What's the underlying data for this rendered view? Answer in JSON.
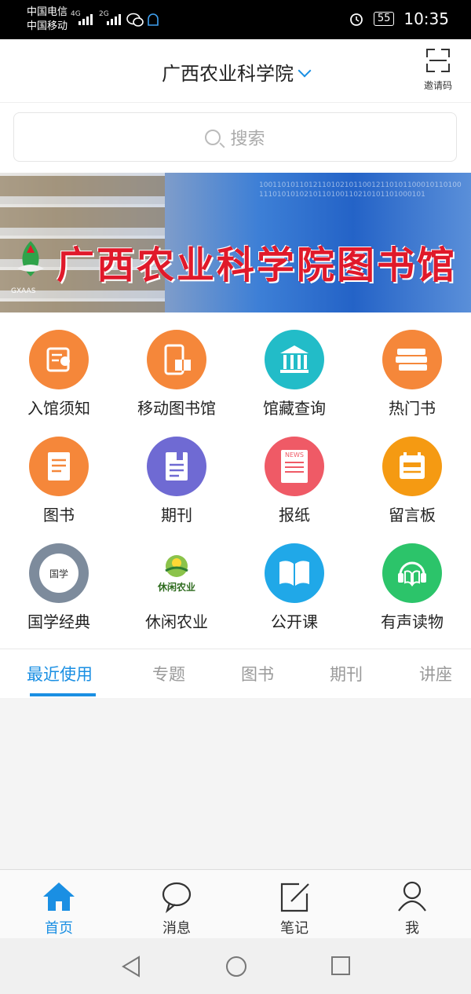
{
  "status_bar": {
    "carrier1": "中国电信",
    "carrier2": "中国移动",
    "net1": "4G",
    "net2": "2G",
    "battery": "55",
    "time": "10:35"
  },
  "header": {
    "title": "广西农业科学院",
    "invite_label": "邀请码"
  },
  "search": {
    "placeholder": "搜索"
  },
  "banner": {
    "title": "广西农业科学院图书馆",
    "logo_text": "GXAAS"
  },
  "grid": [
    {
      "label": "入馆须知",
      "icon": "scroll-icon",
      "color": "#f5873a"
    },
    {
      "label": "移动图书馆",
      "icon": "phone-book-icon",
      "color": "#f5873a"
    },
    {
      "label": "馆藏查询",
      "icon": "library-building-icon",
      "color": "#22bcc8"
    },
    {
      "label": "热门书",
      "icon": "book-stack-icon",
      "color": "#f5873a"
    },
    {
      "label": "图书",
      "icon": "book-icon",
      "color": "#f5873a"
    },
    {
      "label": "期刊",
      "icon": "journal-icon",
      "color": "#6f6ad3"
    },
    {
      "label": "报纸",
      "icon": "newspaper-icon",
      "color": "#ef5a66"
    },
    {
      "label": "留言板",
      "icon": "calendar-board-icon",
      "color": "#f59a12"
    },
    {
      "label": "国学经典",
      "icon": "classics-icon",
      "color": "#7d8b9c"
    },
    {
      "label": "休闲农业",
      "icon": "leisure-agriculture-icon",
      "color": "#ffffff"
    },
    {
      "label": "公开课",
      "icon": "open-book-icon",
      "color": "#20a8e8"
    },
    {
      "label": "有声读物",
      "icon": "audio-book-icon",
      "color": "#2cc46a"
    }
  ],
  "grid_extra": {
    "news_text": "NEWS",
    "guoxue_text": "国学",
    "leisure_text": "休闲农业"
  },
  "tabs": [
    "最近使用",
    "专题",
    "图书",
    "期刊",
    "讲座"
  ],
  "bottom_nav": [
    {
      "label": "首页",
      "icon": "home-icon"
    },
    {
      "label": "消息",
      "icon": "message-icon"
    },
    {
      "label": "笔记",
      "icon": "note-icon"
    },
    {
      "label": "我",
      "icon": "person-icon"
    }
  ],
  "colors": {
    "accent": "#1a8fe3"
  }
}
